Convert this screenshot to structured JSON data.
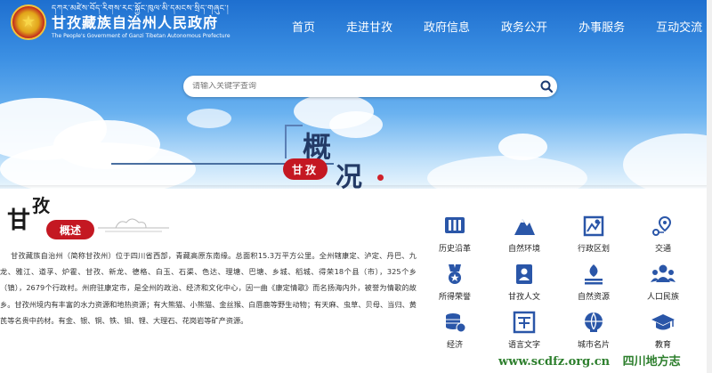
{
  "header": {
    "title_tibetan": "དཀར་མཛེས་བོད་རིགས་རང་སྐྱོང་ཁུལ་མི་དམངས་སྲིད་གཞུང་།",
    "title_cn": "甘孜藏族自治州人民政府",
    "title_en": "The People's Government of Ganzi Tibetan Autonomous Prefecture"
  },
  "nav": {
    "items": [
      {
        "label": "首页"
      },
      {
        "label": "走进甘孜"
      },
      {
        "label": "政府信息"
      },
      {
        "label": "政务公开"
      },
      {
        "label": "办事服务"
      },
      {
        "label": "互动交流"
      }
    ]
  },
  "search": {
    "placeholder": "请输入关键字查询"
  },
  "banner": {
    "gai": "概",
    "kuang": "况",
    "tag": "甘孜"
  },
  "intro": {
    "heading_gan": "甘",
    "heading_zi": "孜",
    "badge": "概述",
    "text": "甘孜藏族自治州（简称甘孜州）位于四川省西部，青藏高原东南缘。总面积15.3万平方公里。全州辖康定、泸定、丹巴、九龙、雅江、道孚、炉霍、甘孜、新龙、德格、白玉、石渠、色达、理塘、巴塘、乡城、稻城、得荣18个县（市），325个乡（镇），2679个行政村。州府驻康定市，是全州的政治、经济和文化中心，因一曲《康定情歌》而名扬海内外，被誉为情歌的故乡。甘孜州境内有丰富的水力资源和地热资源；有大熊猫、小熊猫、金丝猴、白唇鹿等野生动物；有天麻、虫草、贝母、当归、黄芪等名贵中药材。有金、银、铜、铁、钼、锂、大理石、花岗岩等矿产资源。"
  },
  "quick_nav": {
    "items": [
      {
        "label": "历史沿革",
        "icon": "history-icon"
      },
      {
        "label": "自然环境",
        "icon": "mountain-icon"
      },
      {
        "label": "行政区划",
        "icon": "map-icon"
      },
      {
        "label": "交通",
        "icon": "transport-icon"
      },
      {
        "label": "所得荣誉",
        "icon": "medal-icon"
      },
      {
        "label": "甘孜人文",
        "icon": "book-icon"
      },
      {
        "label": "自然资源",
        "icon": "resource-icon"
      },
      {
        "label": "人口民族",
        "icon": "people-icon"
      },
      {
        "label": "经济",
        "icon": "coins-icon"
      },
      {
        "label": "语言文字",
        "icon": "language-icon"
      },
      {
        "label": "城市名片",
        "icon": "city-icon"
      },
      {
        "label": "教育",
        "icon": "education-icon"
      }
    ]
  },
  "watermark": {
    "url": "www.scdfz.org.cn",
    "name": "四川地方志"
  },
  "colors": {
    "brand_red": "#c41822",
    "icon_blue": "#2a56a8",
    "sky_blue": "#3b8fe3"
  }
}
